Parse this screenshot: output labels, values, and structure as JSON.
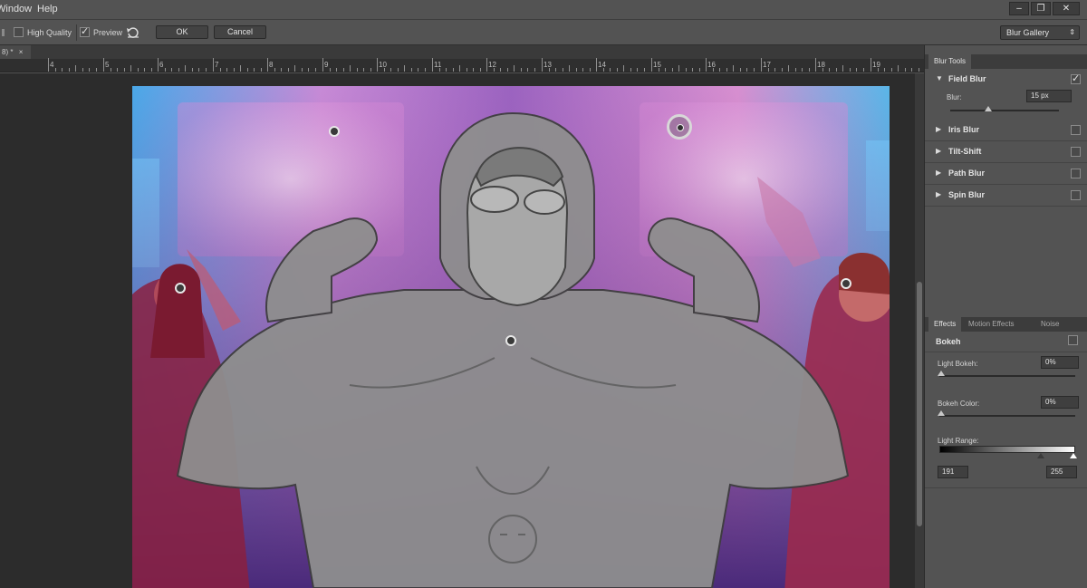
{
  "menu": {
    "window": "Window",
    "help": "Help"
  },
  "window_controls": {
    "minimize": "–",
    "restore": "❐",
    "close": "✕"
  },
  "options_bar": {
    "high_quality_label": "High Quality",
    "high_quality_checked": false,
    "preview_label": "Preview",
    "preview_checked": true,
    "ok_label": "OK",
    "cancel_label": "Cancel",
    "workspace_value": "Blur Gallery"
  },
  "document_tab": {
    "title": "8) *",
    "close": "×"
  },
  "ruler": {
    "ticks": [
      "4",
      "5",
      "6",
      "7",
      "8",
      "9",
      "10",
      "11",
      "12",
      "13",
      "14",
      "15",
      "16",
      "17",
      "18",
      "19"
    ]
  },
  "blur_tools": {
    "tab": "Blur Tools",
    "tools": [
      {
        "name": "Field Blur",
        "expanded": true,
        "checked": true
      },
      {
        "name": "Iris Blur",
        "expanded": false,
        "checked": false
      },
      {
        "name": "Tilt-Shift",
        "expanded": false,
        "checked": false
      },
      {
        "name": "Path Blur",
        "expanded": false,
        "checked": false
      },
      {
        "name": "Spin Blur",
        "expanded": false,
        "checked": false
      }
    ],
    "blur_label": "Blur:",
    "blur_value": "15 px",
    "blur_level": 0.15
  },
  "effects": {
    "tabs": [
      "Effects",
      "Motion Effects",
      "Noise"
    ],
    "bokeh_label": "Bokeh",
    "bokeh_checked": true,
    "light_bokeh_label": "Light Bokeh:",
    "light_bokeh_value": "0%",
    "bokeh_color_label": "Bokeh Color:",
    "bokeh_color_value": "0%",
    "light_range_label": "Light Range:",
    "light_range_low": "191",
    "light_range_high": "255"
  },
  "colors": {
    "panel_bg": "#535353",
    "canvas_bg": "#2c2c2c",
    "accent": "#e6e6e6"
  }
}
